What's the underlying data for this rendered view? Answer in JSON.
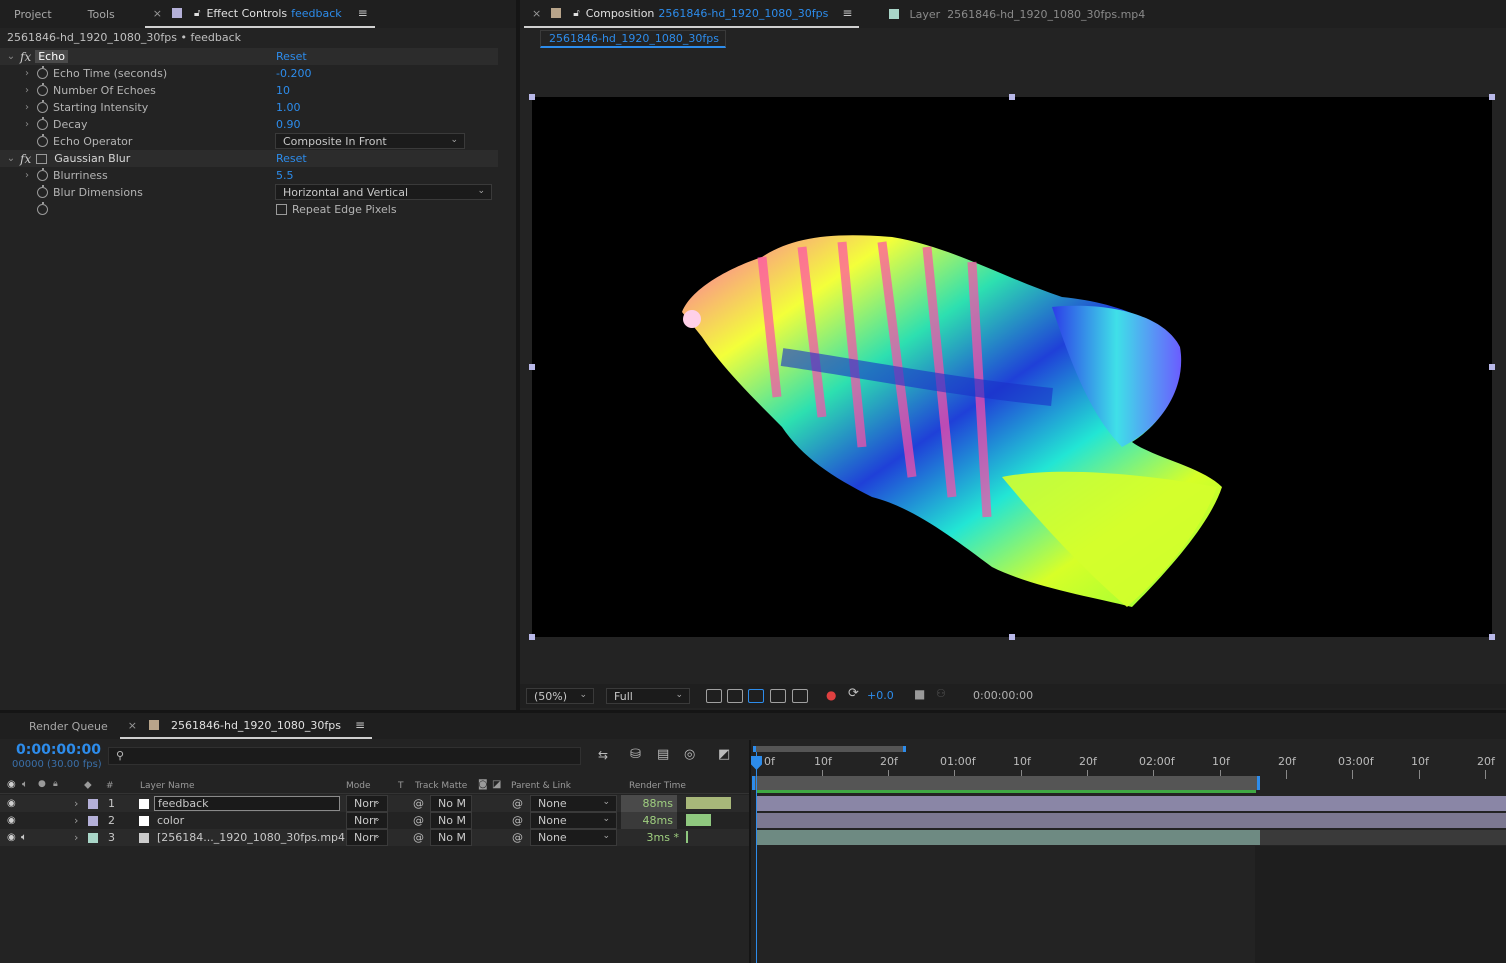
{
  "effect_panel": {
    "tabs": {
      "project": "Project",
      "tools": "Tools",
      "effect_controls_prefix": "Effect Controls",
      "effect_controls_layer": "feedback"
    },
    "breadcrumb": "2561846-hd_1920_1080_30fps • feedback",
    "effects": {
      "echo": {
        "name": "Echo",
        "reset": "Reset",
        "props": [
          {
            "label": "Echo Time (seconds)",
            "value": "-0.200"
          },
          {
            "label": "Number Of Echoes",
            "value": "10"
          },
          {
            "label": "Starting Intensity",
            "value": "1.00"
          },
          {
            "label": "Decay",
            "value": "0.90"
          }
        ],
        "operator_label": "Echo Operator",
        "operator_value": "Composite In Front"
      },
      "blur": {
        "name": "Gaussian Blur",
        "reset": "Reset",
        "blurriness_label": "Blurriness",
        "blurriness_value": "5.5",
        "dimensions_label": "Blur Dimensions",
        "dimensions_value": "Horizontal and Vertical",
        "repeat_edge_label": "Repeat Edge Pixels"
      }
    }
  },
  "comp_panel": {
    "tab_prefix": "Composition",
    "tab_comp": "2561846-hd_1920_1080_30fps",
    "layer_tab": "Layer  2561846-hd_1920_1080_30fps.mp4",
    "sub_tab": "2561846-hd_1920_1080_30fps",
    "footer": {
      "zoom": "(50%)",
      "resolution": "Full",
      "exposure": "+0.0",
      "timecode": "0:00:00:00"
    }
  },
  "timeline": {
    "tabs": {
      "render_queue": "Render Queue",
      "comp": "2561846-hd_1920_1080_30fps"
    },
    "timecode": "0:00:00:00",
    "frames": "00000 (30.00 fps)",
    "columns": {
      "num": "#",
      "layer_name": "Layer Name",
      "mode": "Mode",
      "t": "T",
      "track_matte": "Track Matte",
      "parent": "Parent & Link",
      "render_time": "Render Time"
    },
    "ruler": [
      "0f",
      "10f",
      "20f",
      "01:00f",
      "10f",
      "20f",
      "02:00f",
      "10f",
      "20f",
      "03:00f",
      "10f",
      "20f"
    ],
    "layers": [
      {
        "num": "1",
        "name": "feedback",
        "mode": "Norr",
        "matte": "No M",
        "parent": "None",
        "render": "88ms",
        "render_fraction": 0.75,
        "label_color": "#b4b0d8",
        "icon_color": "#ffffff"
      },
      {
        "num": "2",
        "name": "color",
        "mode": "Norr",
        "matte": "No M",
        "parent": "None",
        "render": "48ms",
        "render_fraction": 0.41,
        "label_color": "#b4b0d8",
        "icon_color": "#ffffff"
      },
      {
        "num": "3",
        "name": "[256184..._1920_1080_30fps.mp4]",
        "mode": "Norr",
        "matte": "No M",
        "parent": "None",
        "render": "3ms *",
        "render_fraction": 0.0,
        "label_color": "#a9d6c8",
        "icon_color": "#cccccc"
      }
    ]
  }
}
